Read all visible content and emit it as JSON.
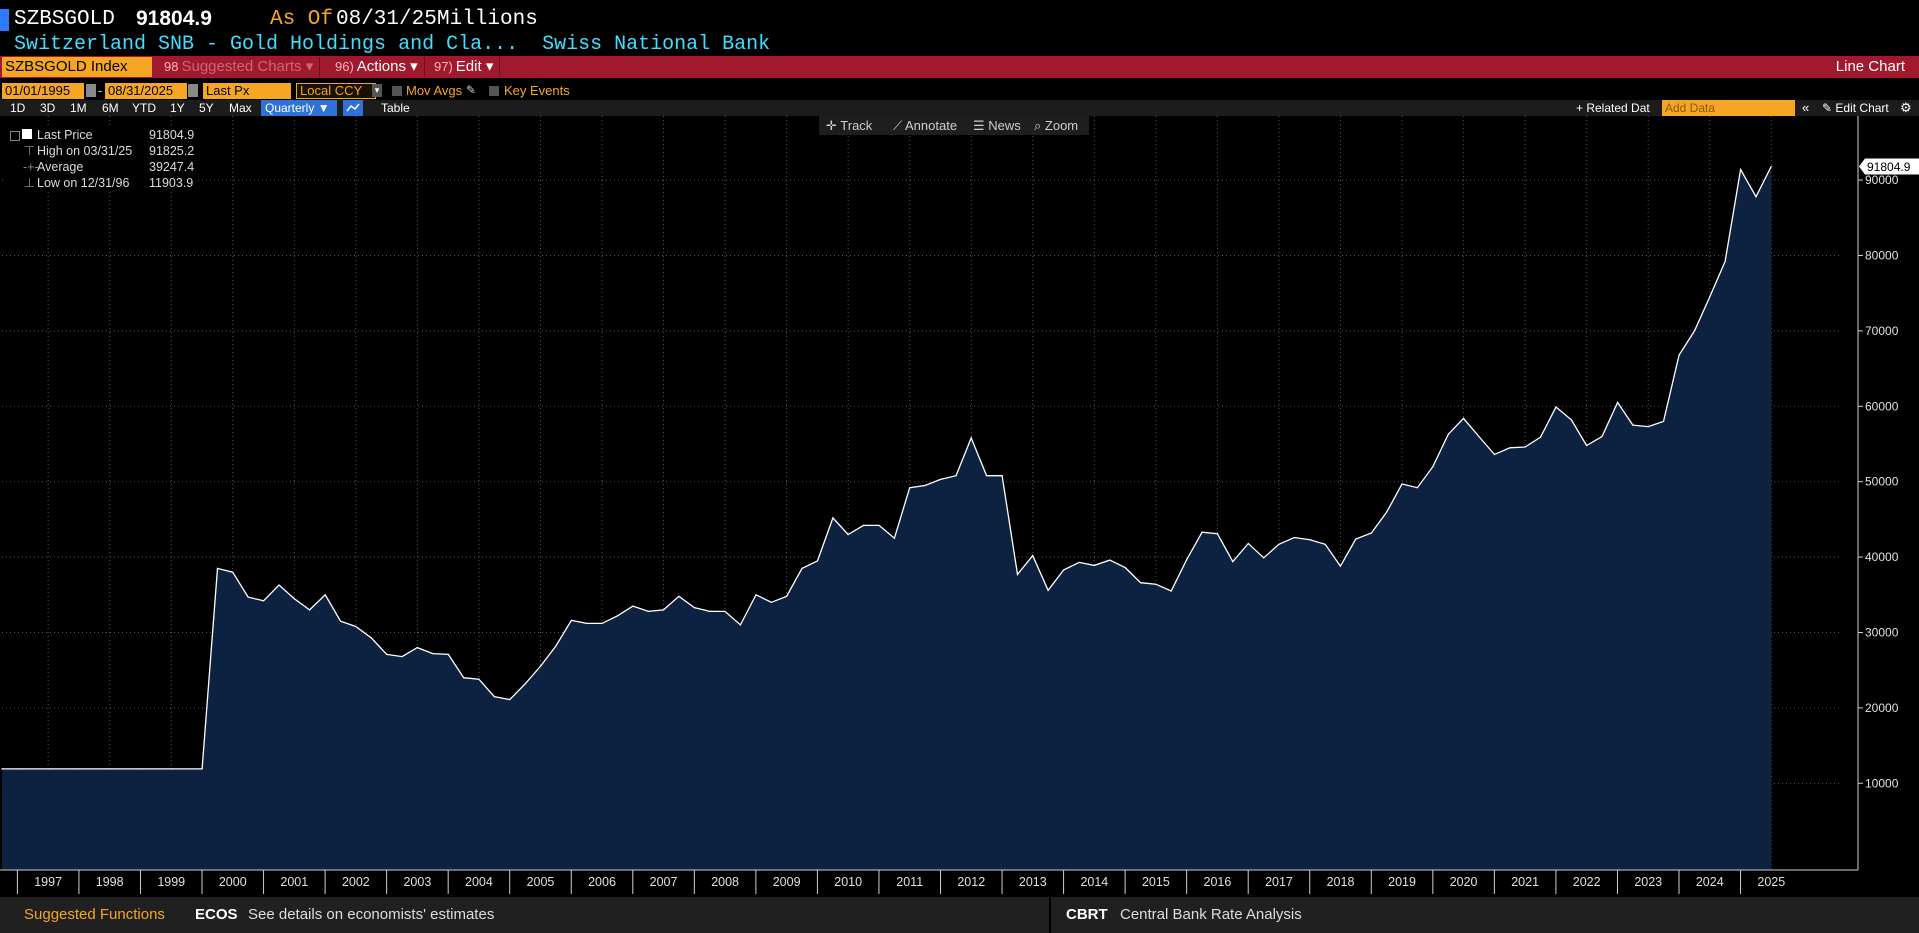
{
  "header": {
    "ticker": "SZBSGOLD",
    "price": "91804.9",
    "as_of_label": "As Of",
    "as_of_date": "08/31/25",
    "units": "Millions",
    "subtitle": "Switzerland SNB - Gold Holdings and Cla...  Swiss National Bank"
  },
  "toolbar": {
    "security": "SZBSGOLD Index",
    "suggested": "Suggested Charts",
    "suggested_num": "98",
    "actions": "Actions",
    "actions_num": "96)",
    "edit": "Edit",
    "edit_num": "97)",
    "chart_type": "Line Chart"
  },
  "options": {
    "start_date": "01/01/1995",
    "end_date": "08/31/2025",
    "field": "Last Px",
    "currency": "Local CCY",
    "mov_avgs": "Mov Avgs",
    "key_events": "Key Events"
  },
  "periods": [
    "1D",
    "3D",
    "1M",
    "6M",
    "YTD",
    "1Y",
    "5Y",
    "Max"
  ],
  "frequency": "Quarterly",
  "table_label": "Table",
  "related_data": "+ Related Dat",
  "add_data_placeholder": "Add Data",
  "edit_chart": "Edit Chart",
  "tools": {
    "track": "Track",
    "annotate": "Annotate",
    "news": "News",
    "zoom": "Zoom"
  },
  "legend": {
    "last_label": "Last Price",
    "last_value": "91804.9",
    "high_label": "High on 03/31/25",
    "high_value": "91825.2",
    "avg_label": "Average",
    "avg_value": "39247.4",
    "low_label": "Low on 12/31/96",
    "low_value": "11903.9"
  },
  "footer": {
    "suggested": "Suggested Functions",
    "ecos_code": "ECOS",
    "ecos_desc": "See details on economists' estimates",
    "cbrt_code": "CBRT",
    "cbrt_desc": "Central Bank Rate Analysis"
  },
  "colors": {
    "accent": "#f5a623",
    "toolbar": "#a0192c",
    "title": "#3fe0ff",
    "area": "#0d2240",
    "line": "#ffffff"
  },
  "chart_data": {
    "type": "area",
    "series": [
      {
        "name": "Last Price",
        "points": [
          [
            "1996-09-30",
            11904
          ],
          [
            "1996-12-31",
            11904
          ],
          [
            "1997-06-30",
            11904
          ],
          [
            "1997-12-31",
            11904
          ],
          [
            "1998-06-30",
            11904
          ],
          [
            "1998-12-31",
            11904
          ],
          [
            "1999-06-30",
            11904
          ],
          [
            "1999-12-31",
            11904
          ],
          [
            "2000-03-31",
            38500
          ],
          [
            "2000-06-30",
            38000
          ],
          [
            "2000-09-30",
            34700
          ],
          [
            "2000-12-31",
            34200
          ],
          [
            "2001-03-31",
            36300
          ],
          [
            "2001-06-30",
            34500
          ],
          [
            "2001-09-30",
            33000
          ],
          [
            "2001-12-31",
            35000
          ],
          [
            "2002-03-31",
            31500
          ],
          [
            "2002-06-30",
            30800
          ],
          [
            "2002-09-30",
            29300
          ],
          [
            "2002-12-31",
            27100
          ],
          [
            "2003-03-31",
            26800
          ],
          [
            "2003-06-30",
            28000
          ],
          [
            "2003-09-30",
            27200
          ],
          [
            "2003-12-31",
            27100
          ],
          [
            "2004-03-31",
            24000
          ],
          [
            "2004-06-30",
            23800
          ],
          [
            "2004-09-30",
            21500
          ],
          [
            "2004-12-31",
            21100
          ],
          [
            "2005-03-31",
            23200
          ],
          [
            "2005-06-30",
            25500
          ],
          [
            "2005-09-30",
            28200
          ],
          [
            "2005-12-31",
            31600
          ],
          [
            "2006-03-31",
            31200
          ],
          [
            "2006-06-30",
            31200
          ],
          [
            "2006-09-30",
            32200
          ],
          [
            "2006-12-31",
            33500
          ],
          [
            "2007-03-31",
            32800
          ],
          [
            "2007-06-30",
            33000
          ],
          [
            "2007-09-30",
            34800
          ],
          [
            "2007-12-31",
            33300
          ],
          [
            "2008-03-31",
            32800
          ],
          [
            "2008-06-30",
            32800
          ],
          [
            "2008-09-30",
            31000
          ],
          [
            "2008-12-31",
            35000
          ],
          [
            "2009-03-31",
            34000
          ],
          [
            "2009-06-30",
            34800
          ],
          [
            "2009-09-30",
            38500
          ],
          [
            "2009-12-31",
            39500
          ],
          [
            "2010-03-31",
            45200
          ],
          [
            "2010-06-30",
            43000
          ],
          [
            "2010-09-30",
            44200
          ],
          [
            "2010-12-31",
            44200
          ],
          [
            "2011-03-31",
            42500
          ],
          [
            "2011-06-30",
            49200
          ],
          [
            "2011-09-30",
            49500
          ],
          [
            "2011-12-31",
            50300
          ],
          [
            "2012-03-31",
            50800
          ],
          [
            "2012-06-30",
            55800
          ],
          [
            "2012-09-30",
            50800
          ],
          [
            "2012-12-31",
            50800
          ],
          [
            "2013-03-31",
            37700
          ],
          [
            "2013-06-30",
            40200
          ],
          [
            "2013-09-30",
            35600
          ],
          [
            "2013-12-31",
            38300
          ],
          [
            "2014-03-31",
            39300
          ],
          [
            "2014-06-30",
            38900
          ],
          [
            "2014-09-30",
            39600
          ],
          [
            "2014-12-31",
            38600
          ],
          [
            "2015-03-31",
            36600
          ],
          [
            "2015-06-30",
            36400
          ],
          [
            "2015-09-30",
            35500
          ],
          [
            "2015-12-31",
            39700
          ],
          [
            "2016-03-31",
            43300
          ],
          [
            "2016-06-30",
            43100
          ],
          [
            "2016-09-30",
            39400
          ],
          [
            "2016-12-31",
            41800
          ],
          [
            "2017-03-31",
            39900
          ],
          [
            "2017-06-30",
            41700
          ],
          [
            "2017-09-30",
            42600
          ],
          [
            "2017-12-31",
            42300
          ],
          [
            "2018-03-31",
            41700
          ],
          [
            "2018-06-30",
            38800
          ],
          [
            "2018-09-30",
            42400
          ],
          [
            "2018-12-31",
            43200
          ],
          [
            "2019-03-31",
            46000
          ],
          [
            "2019-06-30",
            49700
          ],
          [
            "2019-09-30",
            49200
          ],
          [
            "2019-12-31",
            52000
          ],
          [
            "2020-03-31",
            56300
          ],
          [
            "2020-06-30",
            58400
          ],
          [
            "2020-09-30",
            56000
          ],
          [
            "2020-12-31",
            53600
          ],
          [
            "2021-03-31",
            54500
          ],
          [
            "2021-06-30",
            54600
          ],
          [
            "2021-09-30",
            55900
          ],
          [
            "2021-12-31",
            59900
          ],
          [
            "2022-03-31",
            58200
          ],
          [
            "2022-06-30",
            54800
          ],
          [
            "2022-09-30",
            56000
          ],
          [
            "2022-12-31",
            60500
          ],
          [
            "2023-03-31",
            57500
          ],
          [
            "2023-06-30",
            57300
          ],
          [
            "2023-09-30",
            58000
          ],
          [
            "2023-12-31",
            66800
          ],
          [
            "2024-03-31",
            70000
          ],
          [
            "2024-06-30",
            74500
          ],
          [
            "2024-09-30",
            79200
          ],
          [
            "2024-12-31",
            91400
          ],
          [
            "2025-03-31",
            87800
          ],
          [
            "2025-06-30",
            91805
          ]
        ]
      }
    ],
    "x_ticks": [
      "1997",
      "1998",
      "1999",
      "2000",
      "2001",
      "2002",
      "2003",
      "2004",
      "2005",
      "2006",
      "2007",
      "2008",
      "2009",
      "2010",
      "2011",
      "2012",
      "2013",
      "2014",
      "2015",
      "2016",
      "2017",
      "2018",
      "2019",
      "2020",
      "2021",
      "2022",
      "2023",
      "2024",
      "2025"
    ],
    "y_ticks": [
      10000,
      20000,
      30000,
      40000,
      50000,
      60000,
      70000,
      80000,
      90000
    ],
    "last_value_label": "91804.9",
    "ylim": [
      -1500,
      98500
    ],
    "grid": true
  }
}
